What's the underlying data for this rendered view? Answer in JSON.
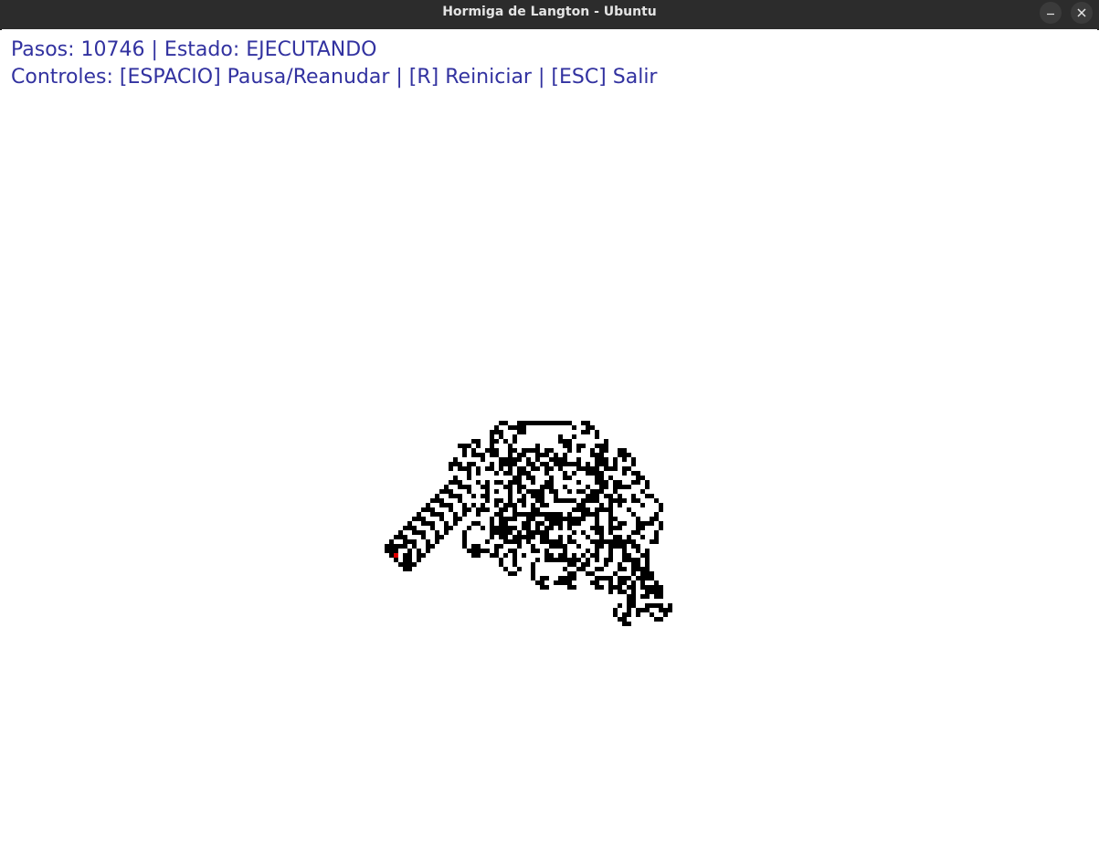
{
  "window": {
    "title": "Hormiga de Langton - Ubuntu"
  },
  "hud": {
    "steps_label": "Pasos:",
    "steps_value": 10746,
    "state_label": "Estado:",
    "state_value": "EJECUTANDO",
    "status_line": "Pasos: 10746 | Estado: EJECUTANDO",
    "controls_line": "Controles: [ESPACIO] Pausa/Reanudar | [R] Reiniciar | [ESC] Salir"
  },
  "colors": {
    "hud_text": "#3232a0",
    "cell_on": "#000000",
    "cell_off": "#ffffff",
    "ant": "#e00000",
    "titlebar": "#2c2c2c"
  },
  "icons": {
    "minimize": "minimize-icon",
    "close": "close-icon"
  },
  "simulation": {
    "rule": "langton-ant",
    "steps": 10746,
    "start_direction": "up"
  }
}
